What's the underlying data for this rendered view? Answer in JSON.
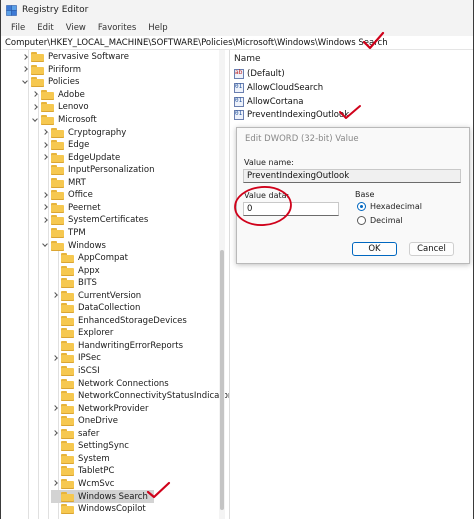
{
  "window": {
    "title": "Registry Editor"
  },
  "menu": [
    "File",
    "Edit",
    "View",
    "Favorites",
    "Help"
  ],
  "address": "Computer\\HKEY_LOCAL_MACHINE\\SOFTWARE\\Policies\\Microsoft\\Windows\\Windows Search",
  "tree": [
    {
      "label": "Pervasive Software",
      "depth": 1,
      "chevron": "right"
    },
    {
      "label": "Piriform",
      "depth": 1,
      "chevron": "right"
    },
    {
      "label": "Policies",
      "depth": 1,
      "chevron": "down"
    },
    {
      "label": "Adobe",
      "depth": 2,
      "chevron": "right"
    },
    {
      "label": "Lenovo",
      "depth": 2,
      "chevron": "right"
    },
    {
      "label": "Microsoft",
      "depth": 2,
      "chevron": "down"
    },
    {
      "label": "Cryptography",
      "depth": 3,
      "chevron": "right"
    },
    {
      "label": "Edge",
      "depth": 3,
      "chevron": "right"
    },
    {
      "label": "EdgeUpdate",
      "depth": 3,
      "chevron": "right"
    },
    {
      "label": "InputPersonalization",
      "depth": 3,
      "chevron": "none"
    },
    {
      "label": "MRT",
      "depth": 3,
      "chevron": "none"
    },
    {
      "label": "Office",
      "depth": 3,
      "chevron": "right"
    },
    {
      "label": "Peernet",
      "depth": 3,
      "chevron": "right"
    },
    {
      "label": "SystemCertificates",
      "depth": 3,
      "chevron": "right"
    },
    {
      "label": "TPM",
      "depth": 3,
      "chevron": "none"
    },
    {
      "label": "Windows",
      "depth": 3,
      "chevron": "down"
    },
    {
      "label": "AppCompat",
      "depth": 4,
      "chevron": "none"
    },
    {
      "label": "Appx",
      "depth": 4,
      "chevron": "none"
    },
    {
      "label": "BITS",
      "depth": 4,
      "chevron": "none"
    },
    {
      "label": "CurrentVersion",
      "depth": 4,
      "chevron": "right"
    },
    {
      "label": "DataCollection",
      "depth": 4,
      "chevron": "none"
    },
    {
      "label": "EnhancedStorageDevices",
      "depth": 4,
      "chevron": "none"
    },
    {
      "label": "Explorer",
      "depth": 4,
      "chevron": "none"
    },
    {
      "label": "HandwritingErrorReports",
      "depth": 4,
      "chevron": "none"
    },
    {
      "label": "IPSec",
      "depth": 4,
      "chevron": "right"
    },
    {
      "label": "iSCSI",
      "depth": 4,
      "chevron": "none"
    },
    {
      "label": "Network Connections",
      "depth": 4,
      "chevron": "none"
    },
    {
      "label": "NetworkConnectivityStatusIndicator",
      "depth": 4,
      "chevron": "none"
    },
    {
      "label": "NetworkProvider",
      "depth": 4,
      "chevron": "right"
    },
    {
      "label": "OneDrive",
      "depth": 4,
      "chevron": "none"
    },
    {
      "label": "safer",
      "depth": 4,
      "chevron": "right"
    },
    {
      "label": "SettingSync",
      "depth": 4,
      "chevron": "none"
    },
    {
      "label": "System",
      "depth": 4,
      "chevron": "none"
    },
    {
      "label": "TabletPC",
      "depth": 4,
      "chevron": "none"
    },
    {
      "label": "WcmSvc",
      "depth": 4,
      "chevron": "right"
    },
    {
      "label": "Windows Search",
      "depth": 4,
      "chevron": "none",
      "selected": true
    },
    {
      "label": "WindowsCopilot",
      "depth": 4,
      "chevron": "none"
    }
  ],
  "values_pane": {
    "header": "Name",
    "items": [
      {
        "name": "(Default)",
        "kind": "string"
      },
      {
        "name": "AllowCloudSearch",
        "kind": "dword"
      },
      {
        "name": "AllowCortana",
        "kind": "dword"
      },
      {
        "name": "PreventIndexingOutlook",
        "kind": "dword"
      }
    ]
  },
  "dialog": {
    "title": "Edit DWORD (32-bit) Value",
    "value_name_label": "Value name:",
    "value_name": "PreventIndexingOutlook",
    "value_data_label": "Value data:",
    "value_data": "0",
    "base_label": "Base",
    "hex_label": "Hexadecimal",
    "dec_label": "Decimal",
    "base_selected": "hexadecimal",
    "ok_label": "OK",
    "cancel_label": "Cancel"
  },
  "colors": {
    "annotation": "#d0021b",
    "accent": "#0067c0",
    "folder": "#f6c850"
  }
}
